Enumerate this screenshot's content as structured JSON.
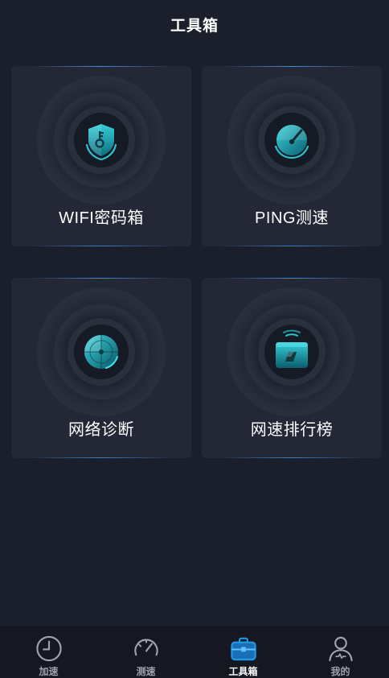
{
  "header": {
    "title": "工具箱"
  },
  "tools": [
    {
      "label": "WIFI密码箱",
      "icon": "shield-key-icon"
    },
    {
      "label": "PING测速",
      "icon": "speed-gauge-icon"
    },
    {
      "label": "网络诊断",
      "icon": "radar-icon"
    },
    {
      "label": "网速排行榜",
      "icon": "trophy-box-icon"
    }
  ],
  "tabbar": {
    "items": [
      {
        "label": "加速",
        "icon": "clock-icon",
        "active": false
      },
      {
        "label": "测速",
        "icon": "speedometer-icon",
        "active": false
      },
      {
        "label": "工具箱",
        "icon": "toolbox-icon",
        "active": true
      },
      {
        "label": "我的",
        "icon": "user-icon",
        "active": false
      }
    ]
  },
  "colors": {
    "background": "#1b1f2b",
    "card": "#242836",
    "accent": "#1fb3c4",
    "tab_active": "#1b9be8",
    "tab_inactive": "#9fa3ad"
  }
}
